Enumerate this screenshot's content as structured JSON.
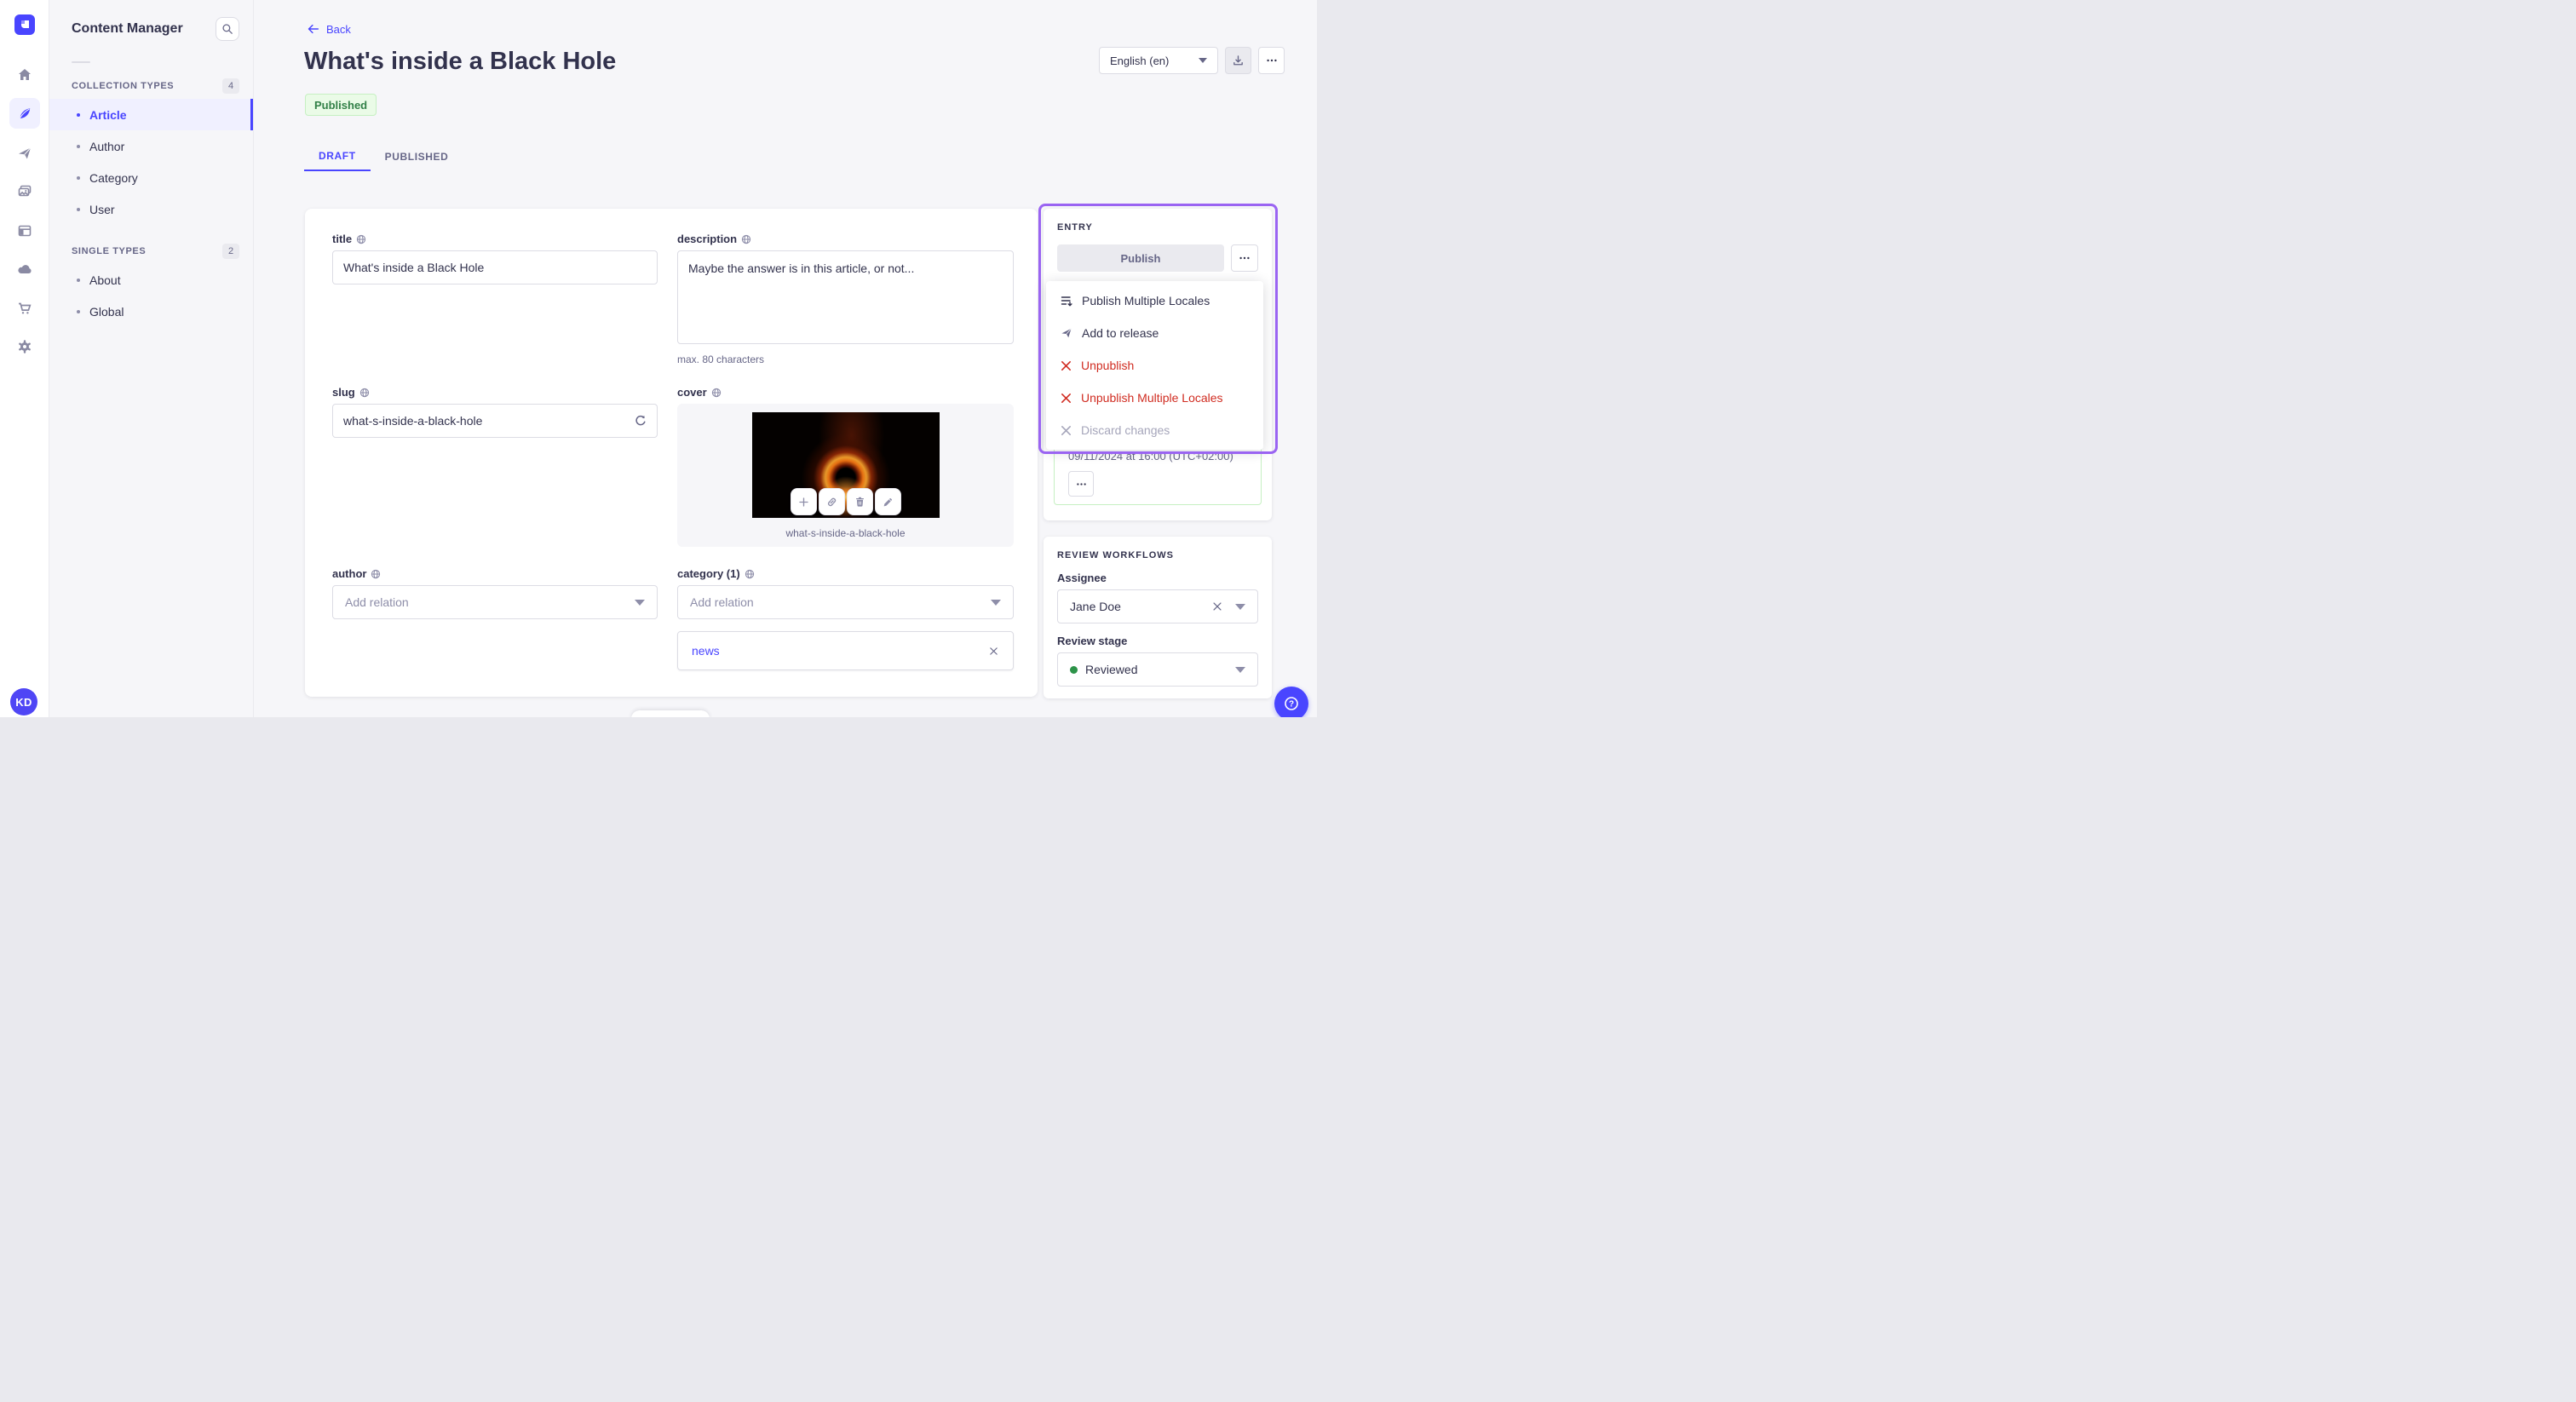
{
  "colors": {
    "accent": "#4945ff",
    "danger": "#d02b20",
    "success_text": "#328048",
    "success_border": "#c6f0c2",
    "highlight_ring": "#9a64f2",
    "stage_dot": "#2d9349"
  },
  "rail": {
    "avatar_initials": "KD"
  },
  "sidebar": {
    "title": "Content Manager",
    "sections": [
      {
        "label": "COLLECTION TYPES",
        "count": "4",
        "items": [
          {
            "label": "Article"
          },
          {
            "label": "Author"
          },
          {
            "label": "Category"
          },
          {
            "label": "User"
          }
        ]
      },
      {
        "label": "SINGLE TYPES",
        "count": "2",
        "items": [
          {
            "label": "About"
          },
          {
            "label": "Global"
          }
        ]
      }
    ]
  },
  "header": {
    "back": "Back",
    "title": "What's inside a Black Hole",
    "status": "Published",
    "locale": "English (en)"
  },
  "tabs": {
    "draft": "DRAFT",
    "published": "PUBLISHED"
  },
  "form": {
    "title": {
      "label": "title",
      "value": "What's inside a Black Hole"
    },
    "description": {
      "label": "description",
      "value": "Maybe the answer is in this article, or not...",
      "hint": "max. 80 characters"
    },
    "slug": {
      "label": "slug",
      "value": "what-s-inside-a-black-hole"
    },
    "cover": {
      "label": "cover",
      "caption": "what-s-inside-a-black-hole"
    },
    "author": {
      "label": "author",
      "placeholder": "Add relation"
    },
    "category": {
      "label": "category (1)",
      "placeholder": "Add relation",
      "relation": "news"
    }
  },
  "entry": {
    "heading": "ENTRY",
    "publish": "Publish",
    "menu": [
      {
        "label": "Publish Multiple Locales"
      },
      {
        "label": "Add to release"
      },
      {
        "label": "Unpublish"
      },
      {
        "label": "Unpublish Multiple Locales"
      },
      {
        "label": "Discard changes"
      }
    ],
    "schedule": "09/11/2024 at 16:00 (UTC+02:00)"
  },
  "review": {
    "heading": "REVIEW WORKFLOWS",
    "assignee_label": "Assignee",
    "assignee_value": "Jane Doe",
    "stage_label": "Review stage",
    "stage_value": "Reviewed"
  }
}
